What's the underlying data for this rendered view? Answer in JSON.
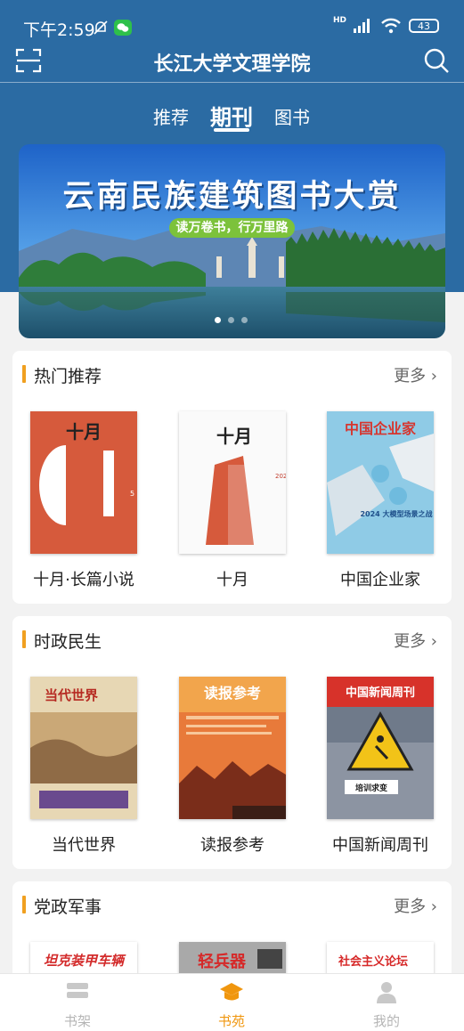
{
  "status_bar": {
    "time": "下午2:59",
    "network": "HD",
    "battery": "43"
  },
  "header": {
    "title": "长江大学文理学院"
  },
  "tabs": [
    {
      "label": "推荐"
    },
    {
      "label": "期刊"
    },
    {
      "label": "图书"
    }
  ],
  "banner": {
    "title": "云南民族建筑图书大赏",
    "subtitle": "读万卷书，行万里路"
  },
  "sections": [
    {
      "title": "热门推荐",
      "more": "更多",
      "items": [
        {
          "title": "十月·长篇小说",
          "cover_text": "十月"
        },
        {
          "title": "十月",
          "cover_text": "十月"
        },
        {
          "title": "中国企业家",
          "cover_text": "中国企业家",
          "cover_sub": "2024 大模型场景之战"
        }
      ]
    },
    {
      "title": "时政民生",
      "more": "更多",
      "items": [
        {
          "title": "当代世界",
          "cover_text": "当代世界"
        },
        {
          "title": "读报参考",
          "cover_text": "读报参考"
        },
        {
          "title": "中国新闻周刊",
          "cover_text": "中国新闻周刊",
          "cover_sub": "培训求变"
        }
      ]
    },
    {
      "title": "党政军事",
      "more": "更多",
      "items": [
        {
          "cover_text": "坦克装甲车辆"
        },
        {
          "cover_text": "轻兵器"
        },
        {
          "cover_text": "社会主义论坛"
        }
      ]
    }
  ],
  "bottom_nav": [
    {
      "label": "书架"
    },
    {
      "label": "书苑"
    },
    {
      "label": "我的"
    }
  ],
  "colors": {
    "primary_blue": "#2b6ba3",
    "accent_orange": "#f0960e"
  }
}
